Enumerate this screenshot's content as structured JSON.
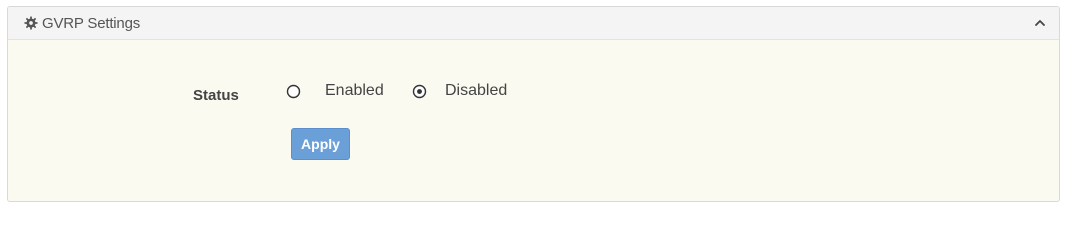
{
  "panel": {
    "title": "GVRP Settings",
    "header_icon": "gear-icon",
    "collapse_icon": "chevron-up-icon"
  },
  "form": {
    "status_label": "Status",
    "options": [
      {
        "label": "Enabled",
        "selected": false
      },
      {
        "label": "Disabled",
        "selected": true
      }
    ],
    "apply_label": "Apply"
  },
  "colors": {
    "panel_background": "#fafaf1",
    "header_background": "#f4f4f4",
    "apply_button": "#6b9fd8"
  }
}
